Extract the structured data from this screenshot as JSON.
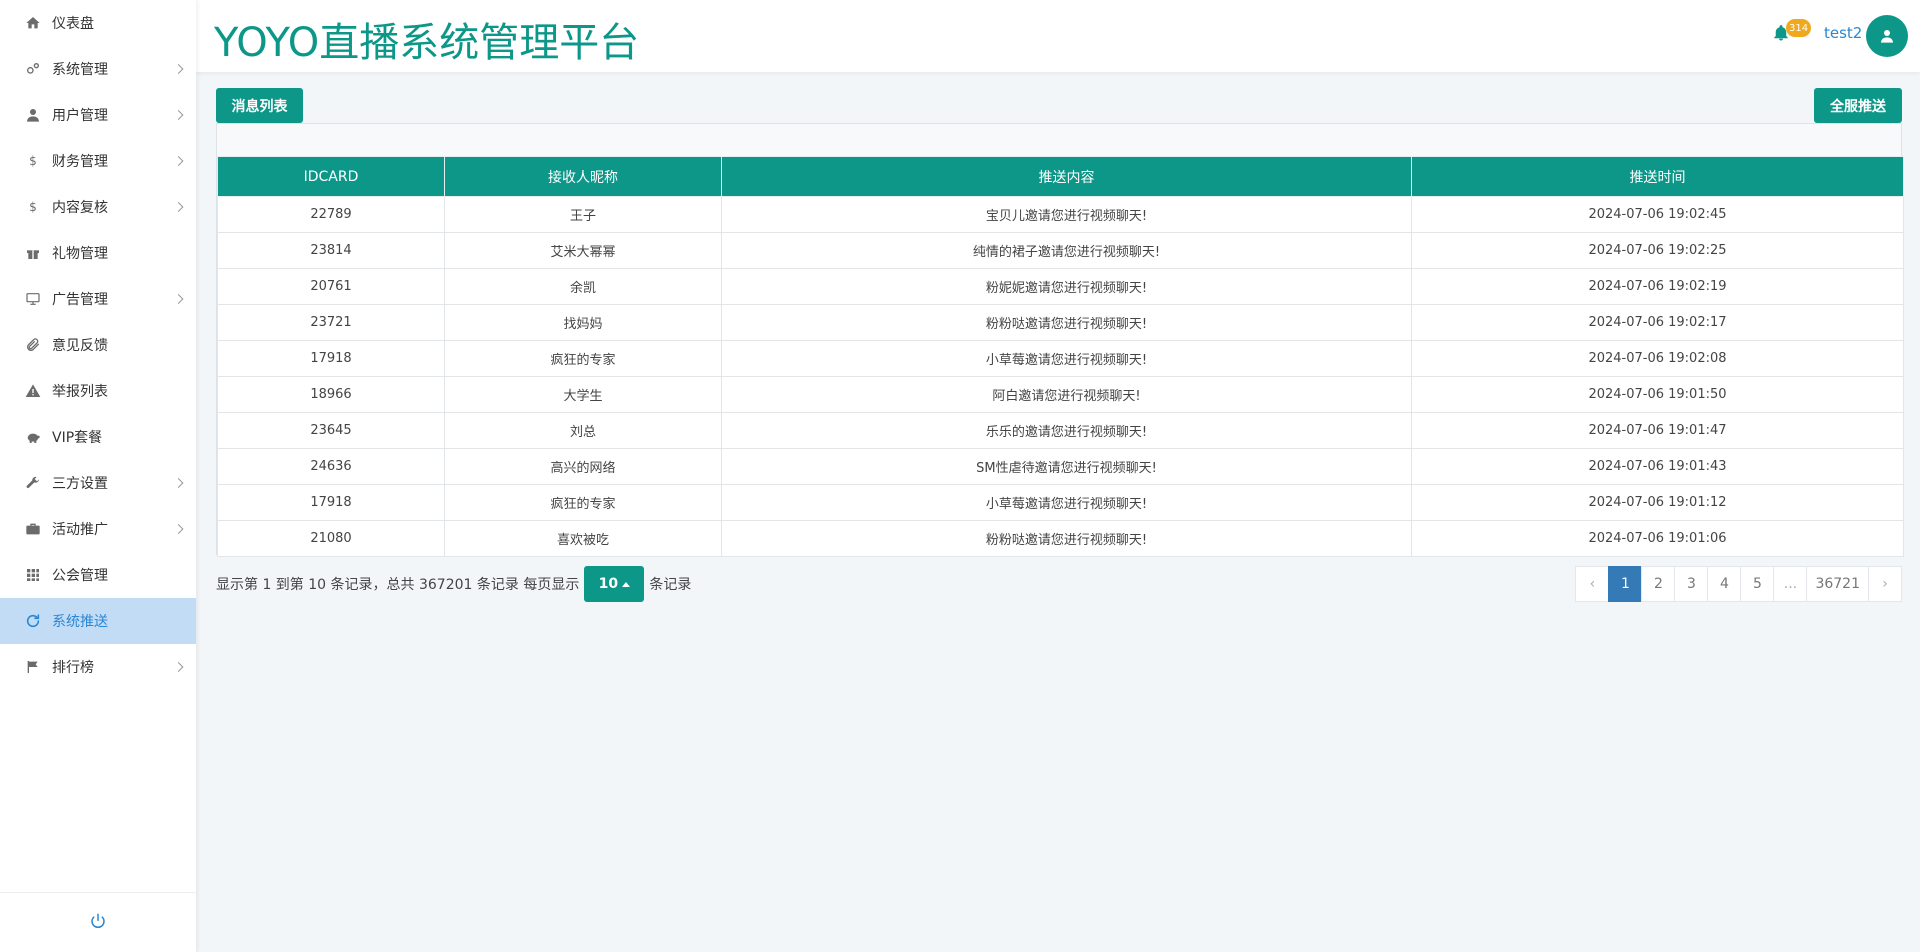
{
  "header": {
    "app_title": "YOYO直播系统管理平台",
    "badge_count": "314",
    "username": "test2"
  },
  "sidebar": {
    "items": [
      {
        "label": "仪表盘",
        "icon": "home-icon",
        "has_children": false,
        "active": false
      },
      {
        "label": "系统管理",
        "icon": "gears-icon",
        "has_children": true,
        "active": false
      },
      {
        "label": "用户管理",
        "icon": "user-icon",
        "has_children": true,
        "active": false
      },
      {
        "label": "财务管理",
        "icon": "dollar-icon",
        "has_children": true,
        "active": false
      },
      {
        "label": "内容复核",
        "icon": "dollar-icon",
        "has_children": true,
        "active": false
      },
      {
        "label": "礼物管理",
        "icon": "gift-icon",
        "has_children": false,
        "active": false
      },
      {
        "label": "广告管理",
        "icon": "ad-icon",
        "has_children": true,
        "active": false
      },
      {
        "label": "意见反馈",
        "icon": "paperclip-icon",
        "has_children": false,
        "active": false
      },
      {
        "label": "举报列表",
        "icon": "warning-icon",
        "has_children": false,
        "active": false
      },
      {
        "label": "VIP套餐",
        "icon": "piggy-bank-icon",
        "has_children": false,
        "active": false
      },
      {
        "label": "三方设置",
        "icon": "wrench-icon",
        "has_children": true,
        "active": false
      },
      {
        "label": "活动推广",
        "icon": "briefcase-icon",
        "has_children": true,
        "active": false
      },
      {
        "label": "公会管理",
        "icon": "grid-icon",
        "has_children": false,
        "active": false
      },
      {
        "label": "系统推送",
        "icon": "refresh-icon",
        "has_children": false,
        "active": true
      },
      {
        "label": "排行榜",
        "icon": "flag-icon",
        "has_children": true,
        "active": false
      }
    ]
  },
  "toolbar": {
    "list_label": "消息列表",
    "push_all_label": "全服推送"
  },
  "table": {
    "columns": [
      "IDCARD",
      "接收人昵称",
      "推送内容",
      "推送时间"
    ],
    "rows": [
      [
        "22789",
        "王子",
        "宝贝儿邀请您进行视频聊天!",
        "2024-07-06 19:02:45"
      ],
      [
        "23814",
        "艾米大幂幂",
        "纯情的裙子邀请您进行视频聊天!",
        "2024-07-06 19:02:25"
      ],
      [
        "20761",
        "余凯",
        "粉妮妮邀请您进行视频聊天!",
        "2024-07-06 19:02:19"
      ],
      [
        "23721",
        "找妈妈",
        "粉粉哒邀请您进行视频聊天!",
        "2024-07-06 19:02:17"
      ],
      [
        "17918",
        "疯狂的专家",
        "小草莓邀请您进行视频聊天!",
        "2024-07-06 19:02:08"
      ],
      [
        "18966",
        "大学生",
        "阿白邀请您进行视频聊天!",
        "2024-07-06 19:01:50"
      ],
      [
        "23645",
        "刘总",
        "乐乐的邀请您进行视频聊天!",
        "2024-07-06 19:01:47"
      ],
      [
        "24636",
        "高兴的网络",
        "SM性虐待邀请您进行视频聊天!",
        "2024-07-06 19:01:43"
      ],
      [
        "17918",
        "疯狂的专家",
        "小草莓邀请您进行视频聊天!",
        "2024-07-06 19:01:12"
      ],
      [
        "21080",
        "喜欢被吃",
        "粉粉哒邀请您进行视频聊天!",
        "2024-07-06 19:01:06"
      ]
    ]
  },
  "pager": {
    "info_prefix": "显示第 1 到第 10 条记录，总共 367201 条记录 每页显示",
    "page_size": "10",
    "info_suffix": "条记录",
    "prev": "‹",
    "next": "›",
    "pages": [
      "1",
      "2",
      "3",
      "4",
      "5",
      "...",
      "36721"
    ],
    "active_page": "1"
  },
  "colors": {
    "brand": "#0c9789",
    "active_nav_bg": "#c3dcf6",
    "active_page": "#337ab7",
    "badge": "#f0a81d"
  }
}
